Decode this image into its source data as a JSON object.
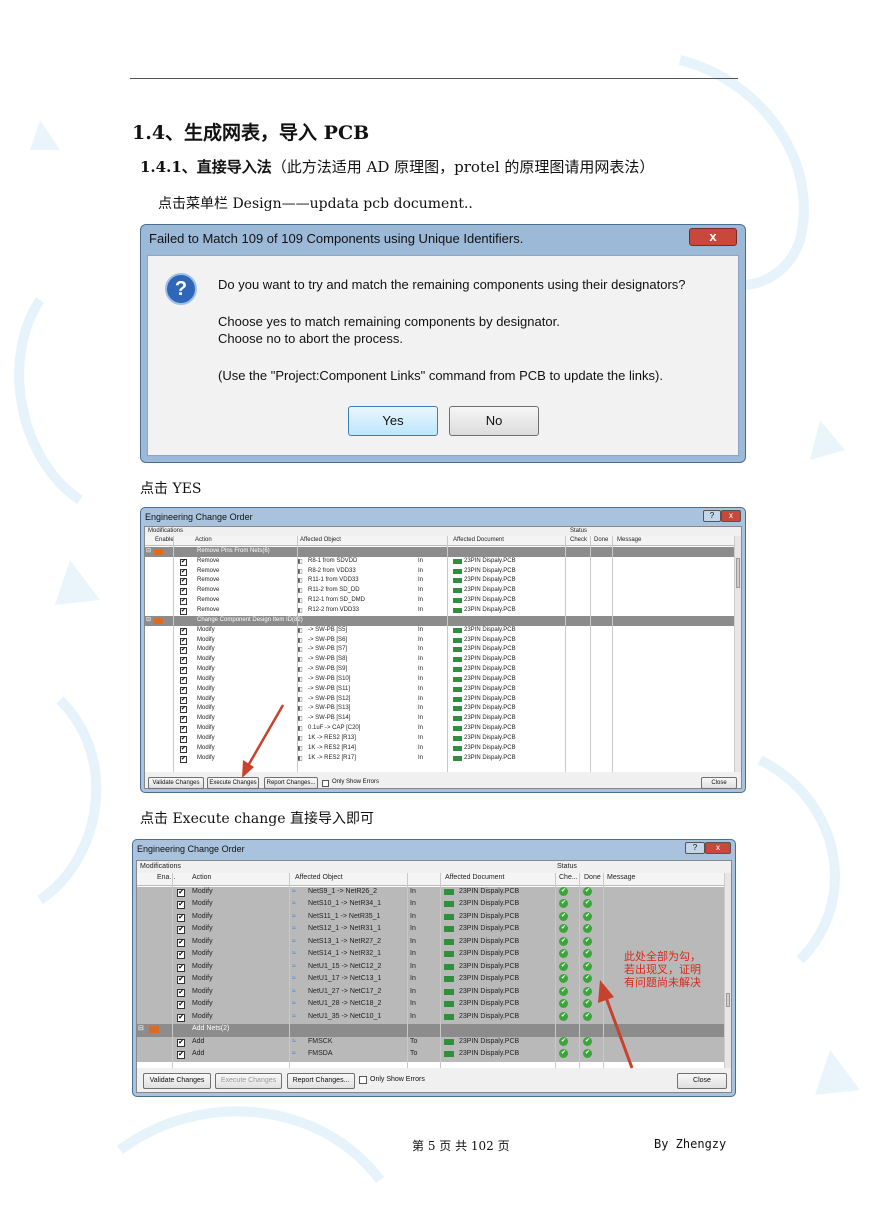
{
  "heading1": "1.4、生成网表，导入 PCB",
  "heading2": {
    "bold": "1.4.1、直接导入法",
    "rest": "（此方法适用 AD 原理图，protel 的原理图请用网表法）"
  },
  "instruction1": "点击菜单栏 Design——updata pcb document..",
  "dialog": {
    "title": "Failed to Match 109 of 109 Components using Unique Identifiers.",
    "close_label": "x",
    "line1": "Do you want to try and match the remaining components using their designators?",
    "line2": "Choose yes to match remaining components by designator.",
    "line3": "Choose no to abort the process.",
    "line4": "(Use the \"Project:Component Links\" command from PCB to update the links).",
    "yes_label": "Yes",
    "no_label": "No"
  },
  "instruction2": "点击 YES",
  "eco1": {
    "title": "Engineering Change Order",
    "modifications": "Modifications",
    "status": "Status",
    "cols": [
      "Enable",
      "Action",
      "Affected Object",
      "Affected Document",
      "Check",
      "Done",
      "Message"
    ],
    "group1": "Remove Pins From Nets(6)",
    "rows1": [
      {
        "action": "Remove",
        "object": "R8-1 from SDVDD",
        "dir": "In",
        "doc": "23PIN Dispaly.PCB"
      },
      {
        "action": "Remove",
        "object": "R8-2 from VDD33",
        "dir": "In",
        "doc": "23PIN Dispaly.PCB"
      },
      {
        "action": "Remove",
        "object": "R11-1 from VDD33",
        "dir": "In",
        "doc": "23PIN Dispaly.PCB"
      },
      {
        "action": "Remove",
        "object": "R11-2 from SD_DD",
        "dir": "In",
        "doc": "23PIN Dispaly.PCB"
      },
      {
        "action": "Remove",
        "object": "R12-1 from SD_DMD",
        "dir": "In",
        "doc": "23PIN Dispaly.PCB"
      },
      {
        "action": "Remove",
        "object": "R12-2 from VDD33",
        "dir": "In",
        "doc": "23PIN Dispaly.PCB"
      }
    ],
    "group2": "Change Component Design Item ID(82)",
    "rows2": [
      {
        "action": "Modify",
        "object": "-> SW-PB [S5]",
        "dir": "In",
        "doc": "23PIN Dispaly.PCB"
      },
      {
        "action": "Modify",
        "object": "-> SW-PB [S6]",
        "dir": "In",
        "doc": "23PIN Dispaly.PCB"
      },
      {
        "action": "Modify",
        "object": "-> SW-PB [S7]",
        "dir": "In",
        "doc": "23PIN Dispaly.PCB"
      },
      {
        "action": "Modify",
        "object": "-> SW-PB [S8]",
        "dir": "In",
        "doc": "23PIN Dispaly.PCB"
      },
      {
        "action": "Modify",
        "object": "-> SW-PB [S9]",
        "dir": "In",
        "doc": "23PIN Dispaly.PCB"
      },
      {
        "action": "Modify",
        "object": "-> SW-PB [S10]",
        "dir": "In",
        "doc": "23PIN Dispaly.PCB"
      },
      {
        "action": "Modify",
        "object": "-> SW-PB [S11]",
        "dir": "In",
        "doc": "23PIN Dispaly.PCB"
      },
      {
        "action": "Modify",
        "object": "-> SW-PB [S12]",
        "dir": "In",
        "doc": "23PIN Dispaly.PCB"
      },
      {
        "action": "Modify",
        "object": "-> SW-PB [S13]",
        "dir": "In",
        "doc": "23PIN Dispaly.PCB"
      },
      {
        "action": "Modify",
        "object": "-> SW-PB [S14]",
        "dir": "In",
        "doc": "23PIN Dispaly.PCB"
      },
      {
        "action": "Modify",
        "object": "0.1uF -> CAP [C20]",
        "dir": "In",
        "doc": "23PIN Dispaly.PCB"
      },
      {
        "action": "Modify",
        "object": "1K -> RES2 [R13]",
        "dir": "In",
        "doc": "23PIN Dispaly.PCB"
      },
      {
        "action": "Modify",
        "object": "1K -> RES2 [R14]",
        "dir": "In",
        "doc": "23PIN Dispaly.PCB"
      },
      {
        "action": "Modify",
        "object": "1K -> RES2 [R17]",
        "dir": "In",
        "doc": "23PIN Dispaly.PCB"
      }
    ],
    "buttons": [
      "Validate Changes",
      "Execute Changes",
      "Report Changes...",
      "Only Show Errors",
      "Close"
    ]
  },
  "instruction3": "点击 Execute change 直接导入即可",
  "eco2": {
    "title": "Engineering Change Order",
    "modifications": "Modifications",
    "status": "Status",
    "cols": [
      "Ena...",
      "Action",
      "Affected Object",
      "Affected Document",
      "Che...",
      "Done",
      "Message"
    ],
    "rows1": [
      {
        "action": "Modify",
        "object": "NetS9_1 -> NetR26_2",
        "dir": "In",
        "doc": "23PIN Dispaly.PCB"
      },
      {
        "action": "Modify",
        "object": "NetS10_1 -> NetR34_1",
        "dir": "In",
        "doc": "23PIN Dispaly.PCB"
      },
      {
        "action": "Modify",
        "object": "NetS11_1 -> NetR35_1",
        "dir": "In",
        "doc": "23PIN Dispaly.PCB"
      },
      {
        "action": "Modify",
        "object": "NetS12_1 -> NetR31_1",
        "dir": "In",
        "doc": "23PIN Dispaly.PCB"
      },
      {
        "action": "Modify",
        "object": "NetS13_1 -> NetR27_2",
        "dir": "In",
        "doc": "23PIN Dispaly.PCB"
      },
      {
        "action": "Modify",
        "object": "NetS14_1 -> NetR32_1",
        "dir": "In",
        "doc": "23PIN Dispaly.PCB"
      },
      {
        "action": "Modify",
        "object": "NetU1_15 -> NetC12_2",
        "dir": "In",
        "doc": "23PIN Dispaly.PCB"
      },
      {
        "action": "Modify",
        "object": "NetU1_17 -> NetC13_1",
        "dir": "In",
        "doc": "23PIN Dispaly.PCB"
      },
      {
        "action": "Modify",
        "object": "NetU1_27 -> NetC17_2",
        "dir": "In",
        "doc": "23PIN Dispaly.PCB"
      },
      {
        "action": "Modify",
        "object": "NetU1_28 -> NetC18_2",
        "dir": "In",
        "doc": "23PIN Dispaly.PCB"
      },
      {
        "action": "Modify",
        "object": "NetU1_35 -> NetC10_1",
        "dir": "In",
        "doc": "23PIN Dispaly.PCB"
      }
    ],
    "group2": "Add Nets(2)",
    "rows2": [
      {
        "action": "Add",
        "object": "FMSCK",
        "dir": "To",
        "doc": "23PIN Dispaly.PCB"
      },
      {
        "action": "Add",
        "object": "FMSDA",
        "dir": "To",
        "doc": "23PIN Dispaly.PCB"
      }
    ],
    "buttons": [
      "Validate Changes",
      "Execute Changes",
      "Report Changes...",
      "Only Show Errors",
      "Close"
    ],
    "annotation": [
      "此处全部为勾，",
      "若出现叉，证明",
      "有问题尚未解决"
    ]
  },
  "footer": {
    "page": "第 5 页 共 102 页",
    "author": "By Zhengzy"
  },
  "colors": {
    "accent_arrow": "#c8412c",
    "title_bar": "#a9c3de",
    "group_row": "#8c8c8c",
    "check_green": "#3aa63a"
  }
}
